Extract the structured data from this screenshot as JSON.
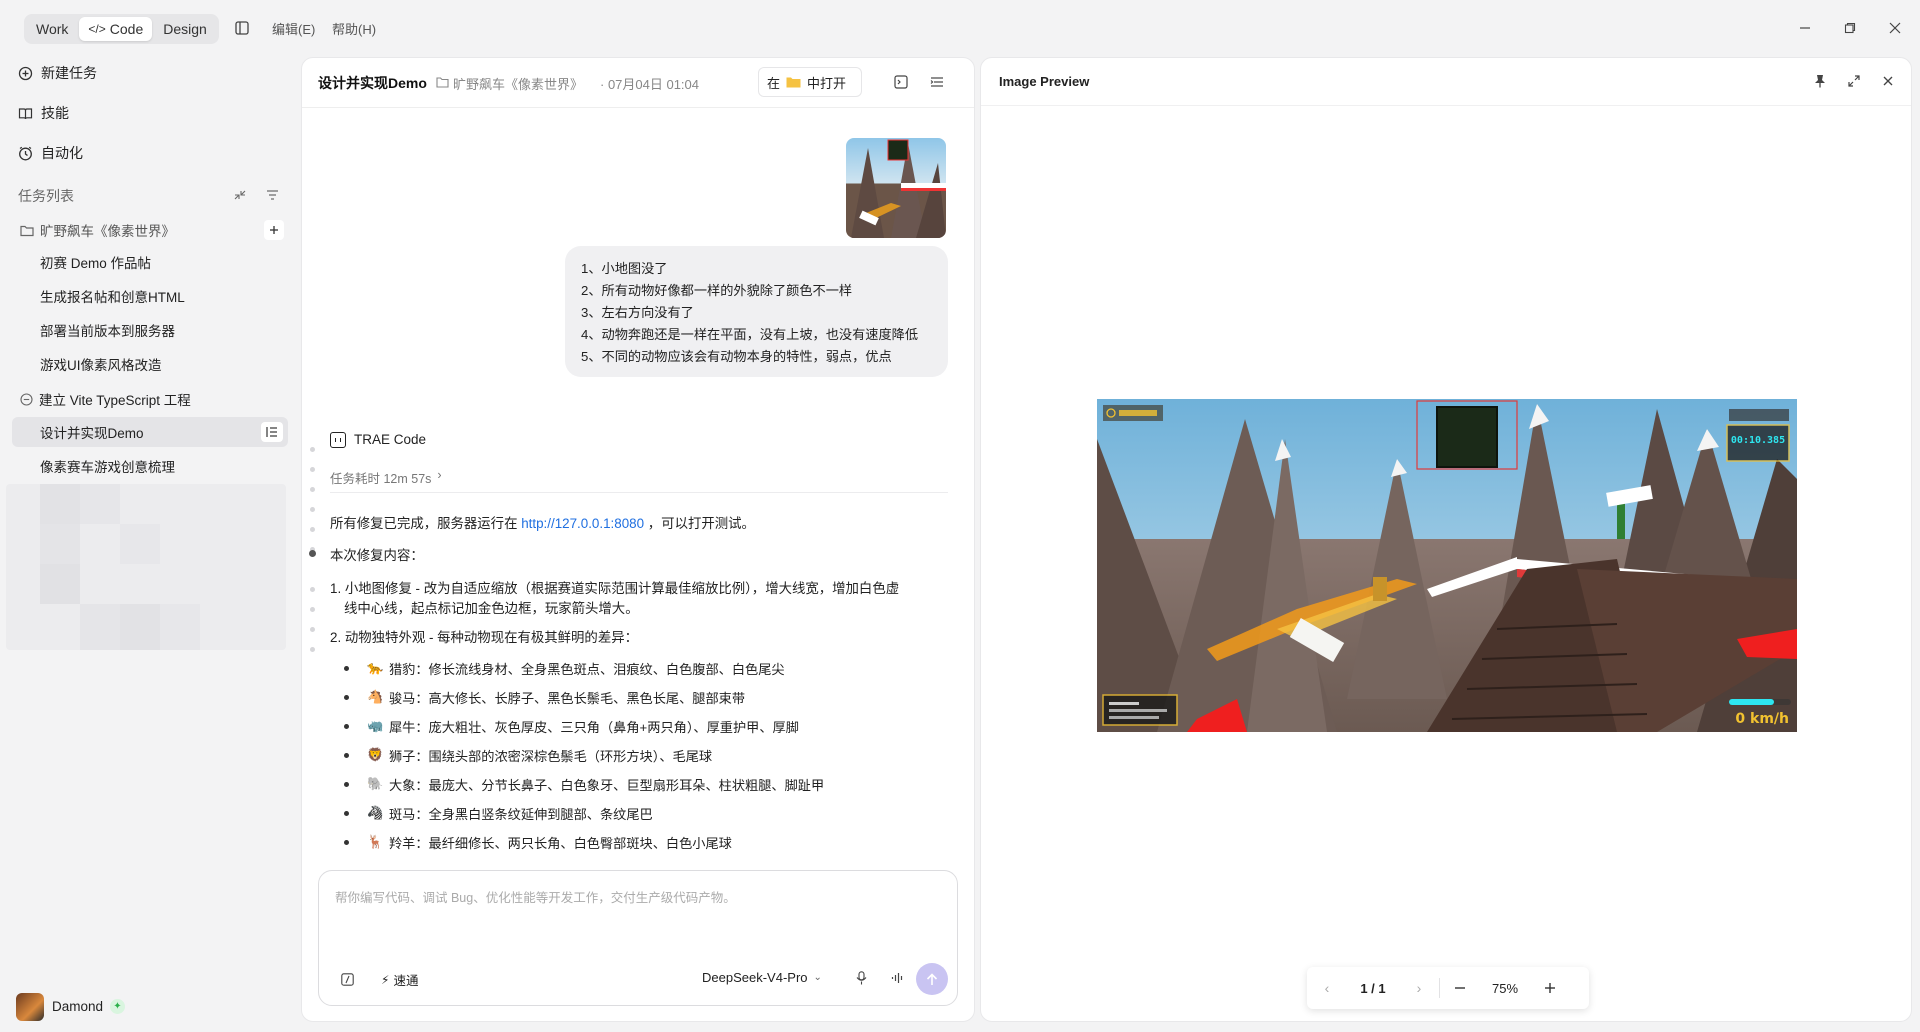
{
  "titlebar": {
    "modes": [
      "Work",
      "Code",
      "Design"
    ],
    "active_mode": "Code",
    "menus": [
      "编辑(E)",
      "帮助(H)"
    ]
  },
  "sidebar": {
    "nav": [
      {
        "label": "新建任务",
        "icon": "add-circle-icon"
      },
      {
        "label": "技能",
        "icon": "book-icon"
      },
      {
        "label": "自动化",
        "icon": "clock-icon"
      }
    ],
    "task_list_label": "任务列表",
    "project_name": "旷野飙车《像素世界》",
    "tasks": [
      "初赛 Demo 作品帖",
      "生成报名帖和创意HTML",
      "部署当前版本到服务器",
      "游戏UI像素风格改造"
    ],
    "subgroup_label": "建立 Vite TypeScript 工程",
    "subgroup_tasks": [
      "设计并实现Demo",
      "像素赛车游戏创意梳理"
    ],
    "active_task": "设计并实现Demo",
    "user_name": "Damond"
  },
  "chat": {
    "title": "设计并实现Demo",
    "project": "旷野飙车《像素世界》",
    "timestamp": "· 07月04日 01:04",
    "open_in_prefix": "在",
    "open_in_suffix": "中打开",
    "user_message_lines": [
      "1、小地图没了",
      "2、所有动物好像都一样的外貌除了颜色不一样",
      "3、左右方向没有了",
      "4、动物奔跑还是一样在平面，没有上坡，也没有速度降低",
      "5、不同的动物应该会有动物本身的特性，弱点，优点"
    ],
    "agent_name": "TRAE Code",
    "task_duration": "任务耗时 12m 57s",
    "response_intro_pre": "所有修复已完成，服务器运行在",
    "response_link": "http://127.0.0.1:8080",
    "response_intro_post": "，可以打开测试。",
    "fix_heading": "本次修复内容：",
    "fix1_line1": "1. 小地图修复 - 改为自适应缩放（根据赛道实际范围计算最佳缩放比例），增大线宽，增加白色虚",
    "fix1_line2": "线中心线，起点标记加金色边框，玩家箭头增大。",
    "fix2": "2. 动物独特外观 - 每种动物现在有极其鲜明的差异：",
    "animals": [
      {
        "emoji": "🐆",
        "text": "猎豹：修长流线身材、全身黑色斑点、泪痕纹、白色腹部、白色尾尖"
      },
      {
        "emoji": "🐴",
        "text": "骏马：高大修长、长脖子、黑色长鬃毛、黑色长尾、腿部束带"
      },
      {
        "emoji": "🦏",
        "text": "犀牛：庞大粗壮、灰色厚皮、三只角（鼻角+两只角）、厚重护甲、厚脚"
      },
      {
        "emoji": "🦁",
        "text": "狮子：围绕头部的浓密深棕色鬃毛（环形方块）、毛尾球"
      },
      {
        "emoji": "🐘",
        "text": "大象：最庞大、分节长鼻子、白色象牙、巨型扇形耳朵、柱状粗腿、脚趾甲"
      },
      {
        "emoji": "🦓",
        "text": "斑马：全身黑白竖条纹延伸到腿部、条纹尾巴"
      },
      {
        "emoji": "🦌",
        "text": "羚羊：最纤细修长、两只长角、白色臀部斑块、白色小尾球"
      }
    ],
    "input_placeholder": "帮你编写代码、调试 Bug、优化性能等开发工作，交付生产级代码产物。",
    "speed_mode": "速通",
    "model": "DeepSeek-V4-Pro"
  },
  "preview": {
    "title": "Image Preview",
    "page": "1 / 1",
    "zoom": "75%",
    "game_hud_time": "00:10.385",
    "game_hud_speed": "0 km/h"
  },
  "colors": {
    "accent": "#1f6fe0",
    "send_button": "#c9c4f2",
    "minimap_border": "#e03a3a",
    "hud_gold": "#f2c230",
    "hud_cyan": "#2ee6f0"
  }
}
